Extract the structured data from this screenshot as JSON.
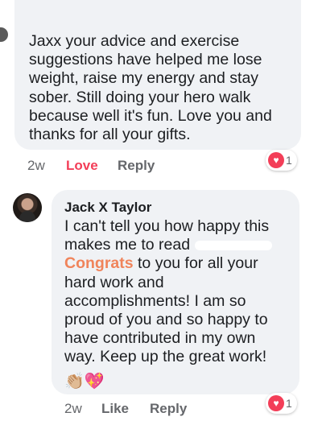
{
  "comment1": {
    "text": "Jaxx your advice and exercise suggestions have helped me lose weight, raise my energy and stay sober. Still doing your hero walk because well it's fun. Love you and thanks for all your gifts.",
    "time": "2w",
    "love_label": "Love",
    "reply_label": "Reply",
    "reaction_icon": "heart-icon",
    "reaction_count": "1"
  },
  "comment2": {
    "author": "Jack X Taylor",
    "text_before": "I can't tell you how happy this makes me to read",
    "highlight": "Congrats",
    "text_after": " to you for all your hard work and accomplishments! I am so proud of you and so happy to have contributed in my own way. Keep up the great work!",
    "emojis": "👏🏼💖",
    "time": "2w",
    "like_label": "Like",
    "reply_label": "Reply",
    "reaction_icon": "heart-icon",
    "reaction_count": "1"
  },
  "colors": {
    "bubble": "#f0f2f5",
    "love_red": "#f33e58",
    "highlight_orange": "#f0845b",
    "meta_gray": "#65676b"
  }
}
